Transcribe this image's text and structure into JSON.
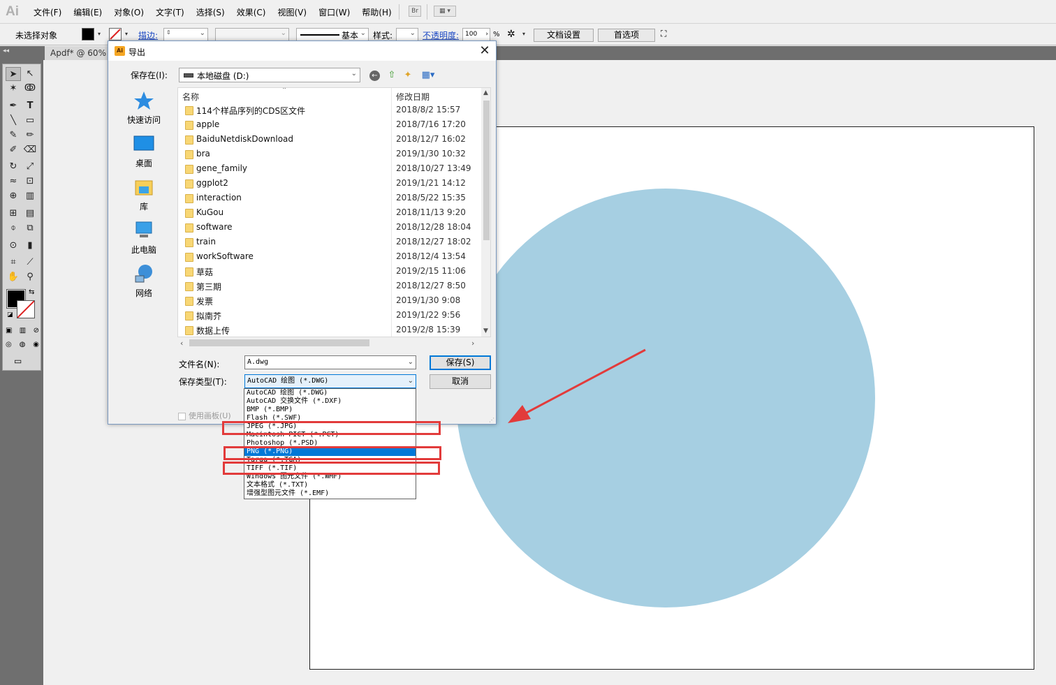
{
  "app": {
    "logo": "Ai",
    "menu": [
      "文件(F)",
      "编辑(E)",
      "对象(O)",
      "文字(T)",
      "选择(S)",
      "效果(C)",
      "视图(V)",
      "窗口(W)",
      "帮助(H)"
    ],
    "bridge_button": "Br"
  },
  "controlbar": {
    "no_selection": "未选择对象",
    "stroke_label": "描边:",
    "stroke_profile": "基本",
    "style_label": "样式:",
    "opacity_label": "不透明度:",
    "opacity_value": "100",
    "opacity_unit": "%",
    "doc_settings": "文档设置",
    "preferences": "首选项"
  },
  "document_tab": "Apdf* @ 60%",
  "dialog": {
    "title": "导出",
    "app_icon": "Ai",
    "save_in_label": "保存在(I):",
    "save_in_value": "本地磁盘 (D:)",
    "places": [
      {
        "label": "快速访问",
        "icon": "star-icon"
      },
      {
        "label": "桌面",
        "icon": "desktop-icon"
      },
      {
        "label": "库",
        "icon": "library-icon"
      },
      {
        "label": "此电脑",
        "icon": "computer-icon"
      },
      {
        "label": "网络",
        "icon": "network-icon"
      }
    ],
    "columns": {
      "name": "名称",
      "date": "修改日期"
    },
    "files": [
      {
        "name": "114个样品序列的CDS区文件",
        "date": "2018/8/2 15:57"
      },
      {
        "name": "apple",
        "date": "2018/7/16 17:20"
      },
      {
        "name": "BaiduNetdiskDownload",
        "date": "2018/12/7 16:02"
      },
      {
        "name": "bra",
        "date": "2019/1/30 10:32"
      },
      {
        "name": "gene_family",
        "date": "2018/10/27 13:49"
      },
      {
        "name": "ggplot2",
        "date": "2019/1/21 14:12"
      },
      {
        "name": "interaction",
        "date": "2018/5/22 15:35"
      },
      {
        "name": "KuGou",
        "date": "2018/11/13 9:20"
      },
      {
        "name": "software",
        "date": "2018/12/28 18:04"
      },
      {
        "name": "train",
        "date": "2018/12/27 18:02"
      },
      {
        "name": "workSoftware",
        "date": "2018/12/4 13:54"
      },
      {
        "name": "草菇",
        "date": "2019/2/15 11:06"
      },
      {
        "name": "第三期",
        "date": "2018/12/27 8:50"
      },
      {
        "name": "发票",
        "date": "2019/1/30 9:08"
      },
      {
        "name": "拟南芥",
        "date": "2019/1/22 9:56"
      },
      {
        "name": "数据上传",
        "date": "2019/2/8 15:39"
      }
    ],
    "filename_label": "文件名(N):",
    "filename_value": "A.dwg",
    "filetype_label": "保存类型(T):",
    "filetype_value": "AutoCAD 绘图 (*.DWG)",
    "save_button": "保存(S)",
    "cancel_button": "取消",
    "use_artboard": "使用画板(U)",
    "filetype_options": [
      "AutoCAD 绘图 (*.DWG)",
      "AutoCAD 交换文件 (*.DXF)",
      "BMP (*.BMP)",
      "Flash (*.SWF)",
      "JPEG (*.JPG)",
      "Macintosh PICT (*.PCT)",
      "Photoshop (*.PSD)",
      "PNG (*.PNG)",
      "Targa (*.TGA)",
      "TIFF (*.TIF)",
      "Windows 图元文件 (*.WMF)",
      "文本格式 (*.TXT)",
      "增强型图元文件 (*.EMF)"
    ],
    "selected_option": "PNG (*.PNG)"
  },
  "colors": {
    "circle_fill": "#a6cfe2",
    "annotation_red": "#e23b3b",
    "selection_blue": "#0078d7"
  }
}
